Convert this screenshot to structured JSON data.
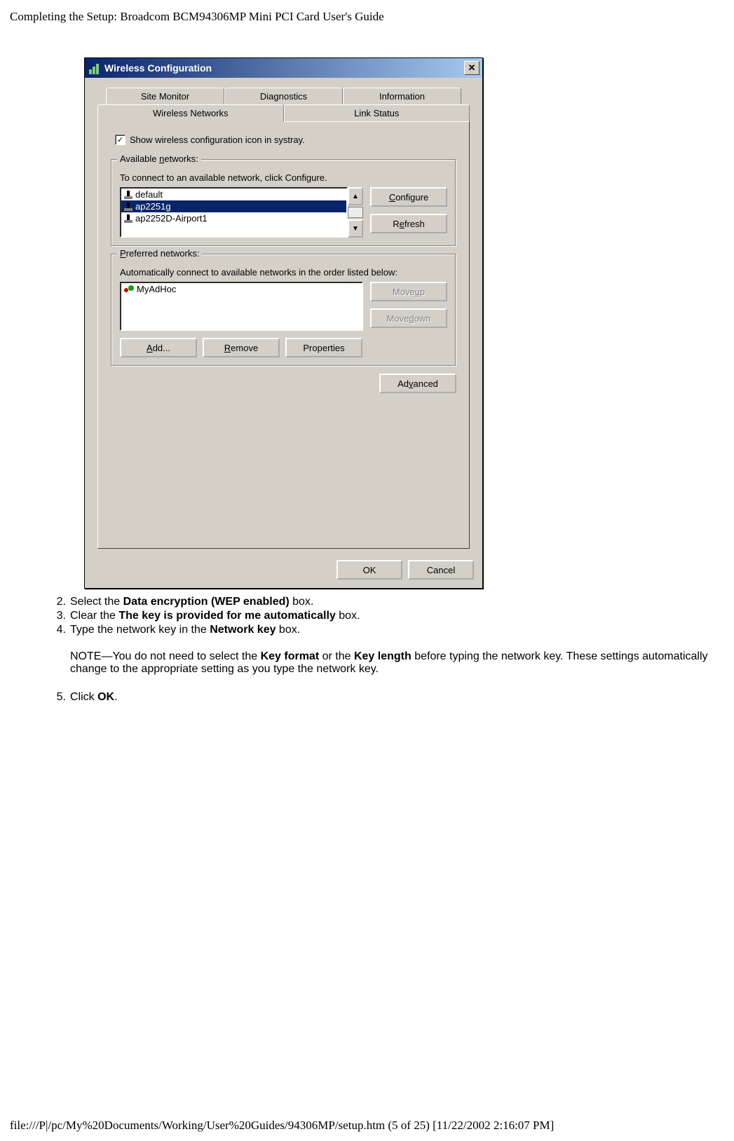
{
  "header": "Completing the Setup: Broadcom BCM94306MP Mini PCI Card User's Guide",
  "dlg": {
    "title": "Wireless Configuration",
    "tabs_top": [
      "Site Monitor",
      "Diagnostics",
      "Information"
    ],
    "tabs_bot": [
      "Wireless Networks",
      "Link Status"
    ],
    "systray_chk": "Show wireless configuration icon in systray.",
    "available": {
      "legend_pre": "Available ",
      "legend_u": "n",
      "legend_post": "etworks:",
      "hint": "To connect to an available network, click Configure.",
      "items": [
        "default",
        "ap2251g",
        "ap2252D-Airport1"
      ],
      "selected_index": 1,
      "configure_u": "C",
      "configure_post": "onfigure",
      "refresh_pre": "R",
      "refresh_u": "e",
      "refresh_post": "fresh"
    },
    "preferred": {
      "legend_u": "P",
      "legend_post": "referred networks:",
      "hint": "Automatically connect to available networks in the order listed below:",
      "items": [
        "MyAdHoc"
      ],
      "moveup_pre": "Move ",
      "moveup_u": "u",
      "moveup_post": "p",
      "movedown_pre": "Move ",
      "movedown_u": "d",
      "movedown_post": "own",
      "add_u": "A",
      "add_post": "dd...",
      "remove_u": "R",
      "remove_post": "emove",
      "properties": "Properties"
    },
    "advanced_pre": "Ad",
    "advanced_u": "v",
    "advanced_post": "anced",
    "ok": "OK",
    "cancel": "Cancel"
  },
  "steps": {
    "s2_pre": "Select the ",
    "s2_b": "Data encryption (WEP enabled)",
    "s2_post": " box.",
    "s3_pre": "Clear the ",
    "s3_b": "The key is provided for me automatically",
    "s3_post": " box.",
    "s4_pre": "Type the network key in the ",
    "s4_b": "Network key",
    "s4_post": " box.",
    "note_pre": "NOTE—You do not need to select the ",
    "note_b1": "Key format",
    "note_mid": " or the ",
    "note_b2": "Key length",
    "note_end": " before typing the network key. These settings automatically change to the appropriate setting as you type the network key.",
    "s5_pre": "Click ",
    "s5_b": "OK",
    "s5_post": "."
  },
  "footer": "file:///P|/pc/My%20Documents/Working/User%20Guides/94306MP/setup.htm (5 of 25) [11/22/2002 2:16:07 PM]"
}
